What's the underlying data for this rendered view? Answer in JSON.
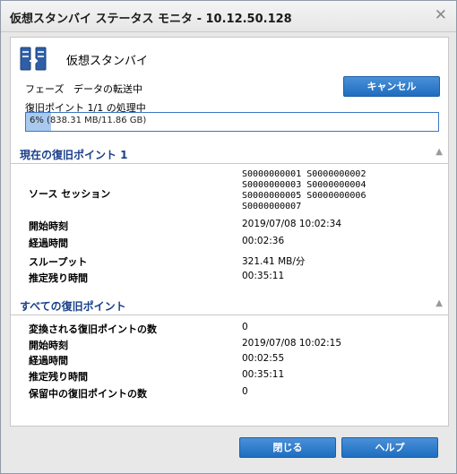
{
  "window": {
    "title": "仮想スタンバイ ステータス モニタ - 10.12.50.128"
  },
  "header": {
    "title": "仮想スタンバイ",
    "icon": "standby-servers-icon"
  },
  "phase": {
    "label": "フェーズ",
    "value": "データの転送中"
  },
  "cancel_label": "キャンセル",
  "recovery_status": "復旧ポイント 1/1 の処理中",
  "progress": {
    "fraction": 0.06,
    "text": "6% (838.31 MB/11.86 GB)"
  },
  "current": {
    "title": "現在の復旧ポイント 1",
    "source_session_label": "ソース セッション",
    "sessions_lines": [
      "S0000000001 S0000000002",
      "S0000000003 S0000000004",
      "S0000000005 S0000000006",
      "S0000000007"
    ],
    "start_label": "開始時刻",
    "start_value": "2019/07/08 10:02:34",
    "elapsed_label": "経過時間",
    "elapsed_value": "00:02:36",
    "throughput_label": "スループット",
    "throughput_value": "321.41 MB/分",
    "remaining_label": "推定残り時間",
    "remaining_value": "00:35:11"
  },
  "all": {
    "title": "すべての復旧ポイント",
    "converted_label": "変換される復旧ポイントの数",
    "converted_value": "0",
    "start_label": "開始時刻",
    "start_value": "2019/07/08 10:02:15",
    "elapsed_label": "経過時間",
    "elapsed_value": "00:02:55",
    "remaining_label": "推定残り時間",
    "remaining_value": "00:35:11",
    "pending_label": "保留中の復旧ポイントの数",
    "pending_value": "0"
  },
  "footer": {
    "close_label": "閉じる",
    "help_label": "ヘルプ"
  }
}
